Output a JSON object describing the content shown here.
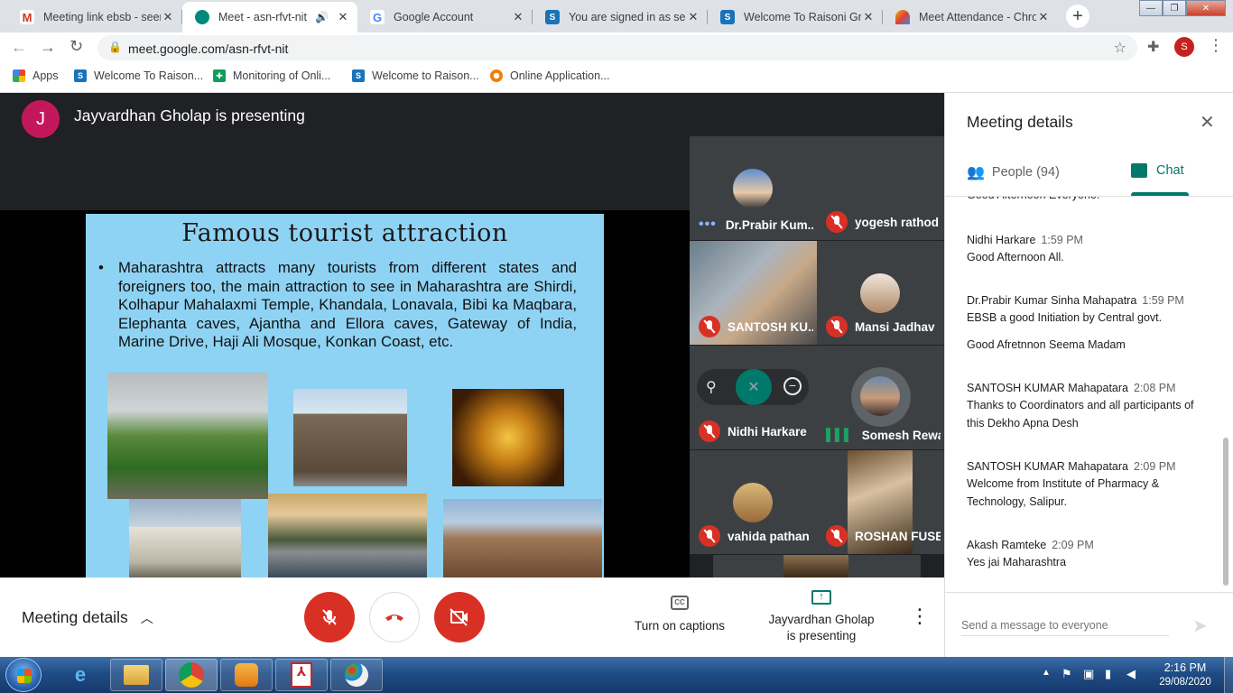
{
  "browser": {
    "tabs": [
      {
        "title": "Meeting link ebsb - seem",
        "icon": "gmail-icon",
        "color": "#d93025",
        "letter": "M"
      },
      {
        "title": "Meet - asn-rfvt-nit",
        "icon": "meet-icon",
        "color": "#00897b",
        "letter": ""
      },
      {
        "title": "Google Account",
        "icon": "google-icon",
        "color": "#4285f4",
        "letter": "G"
      },
      {
        "title": "You are signed in as seem",
        "icon": "s-icon",
        "color": "#1a73b8",
        "letter": "S"
      },
      {
        "title": "Welcome To Raisoni Gro",
        "icon": "s-icon",
        "color": "#1a73b8",
        "letter": "S"
      },
      {
        "title": "Meet Attendance - Chro",
        "icon": "extension-icon",
        "color": "#f4b400",
        "letter": ""
      }
    ],
    "url": "meet.google.com/asn-rfvt-nit",
    "profile_letter": "S",
    "bookmarks": [
      {
        "label": "Apps"
      },
      {
        "label": "Welcome To Raison..."
      },
      {
        "label": "Monitoring of Onli..."
      },
      {
        "label": "Welcome to Raison..."
      },
      {
        "label": "Online Application..."
      }
    ]
  },
  "meet": {
    "presenter_initial": "J",
    "presenter_text": "Jayvardhan Gholap is presenting",
    "slide": {
      "title": "Famous tourist attraction",
      "bullet": "•",
      "body": "Maharashtra attracts many tourists from different states and foreigners too, the main attraction to see in Maharashtra are Shirdi, Kolhapur Mahalaxmi Temple, Khandala, Lonavala, Bibi ka Maqbara, Elephanta caves, Ajantha and Ellora caves, Gateway of India, Marine Drive, Haji Ali Mosque, Konkan Coast, etc."
    },
    "participants": [
      {
        "name": "Dr.Prabir Kum...",
        "status": "more"
      },
      {
        "name": "yogesh rathod",
        "status": "muted"
      },
      {
        "name": "SANTOSH KU...",
        "status": "muted"
      },
      {
        "name": "Mansi Jadhav",
        "status": "muted"
      },
      {
        "name": "Nidhi Harkare",
        "status": "muted"
      },
      {
        "name": "Somesh Rewa...",
        "status": "speaking"
      },
      {
        "name": "vahida pathan",
        "status": "muted"
      },
      {
        "name": "ROSHAN FUSE",
        "status": "muted"
      }
    ],
    "bottom": {
      "details_label": "Meeting details",
      "captions_label": "Turn on captions",
      "presenting_line1": "Jayvardhan Gholap",
      "presenting_line2": "is presenting"
    }
  },
  "panel": {
    "title": "Meeting details",
    "tab_people": "People (94)",
    "tab_chat": "Chat",
    "messages": [
      {
        "sender": "",
        "time": "",
        "text": "Good Afternoon Everyone!"
      },
      {
        "sender": "Nidhi Harkare",
        "time": "1:59 PM",
        "text": "Good Afternoon All."
      },
      {
        "sender": "Dr.Prabir Kumar Sinha Mahapatra",
        "time": "1:59 PM",
        "text": "EBSB  a good Initiation by Central govt."
      },
      {
        "sender": "",
        "time": "",
        "text": "Good Afretnnon Seema Madam"
      },
      {
        "sender": "SANTOSH KUMAR Mahapatara",
        "time": "2:08 PM",
        "text": "Thanks to  Coordinators and all participants of this Dekho Apna Desh"
      },
      {
        "sender": "SANTOSH KUMAR Mahapatara",
        "time": "2:09 PM",
        "text": "Welcome from Institute of Pharmacy & Technology, Salipur."
      },
      {
        "sender": "Akash Ramteke",
        "time": "2:09 PM",
        "text": "Yes jai Maharashtra"
      }
    ],
    "input_placeholder": "Send a message to everyone"
  },
  "taskbar": {
    "time": "2:16 PM",
    "date": "29/08/2020"
  },
  "colors": {
    "meet_red": "#d93025",
    "meet_green": "#00796b",
    "slide_bg": "#8fd3f4"
  }
}
